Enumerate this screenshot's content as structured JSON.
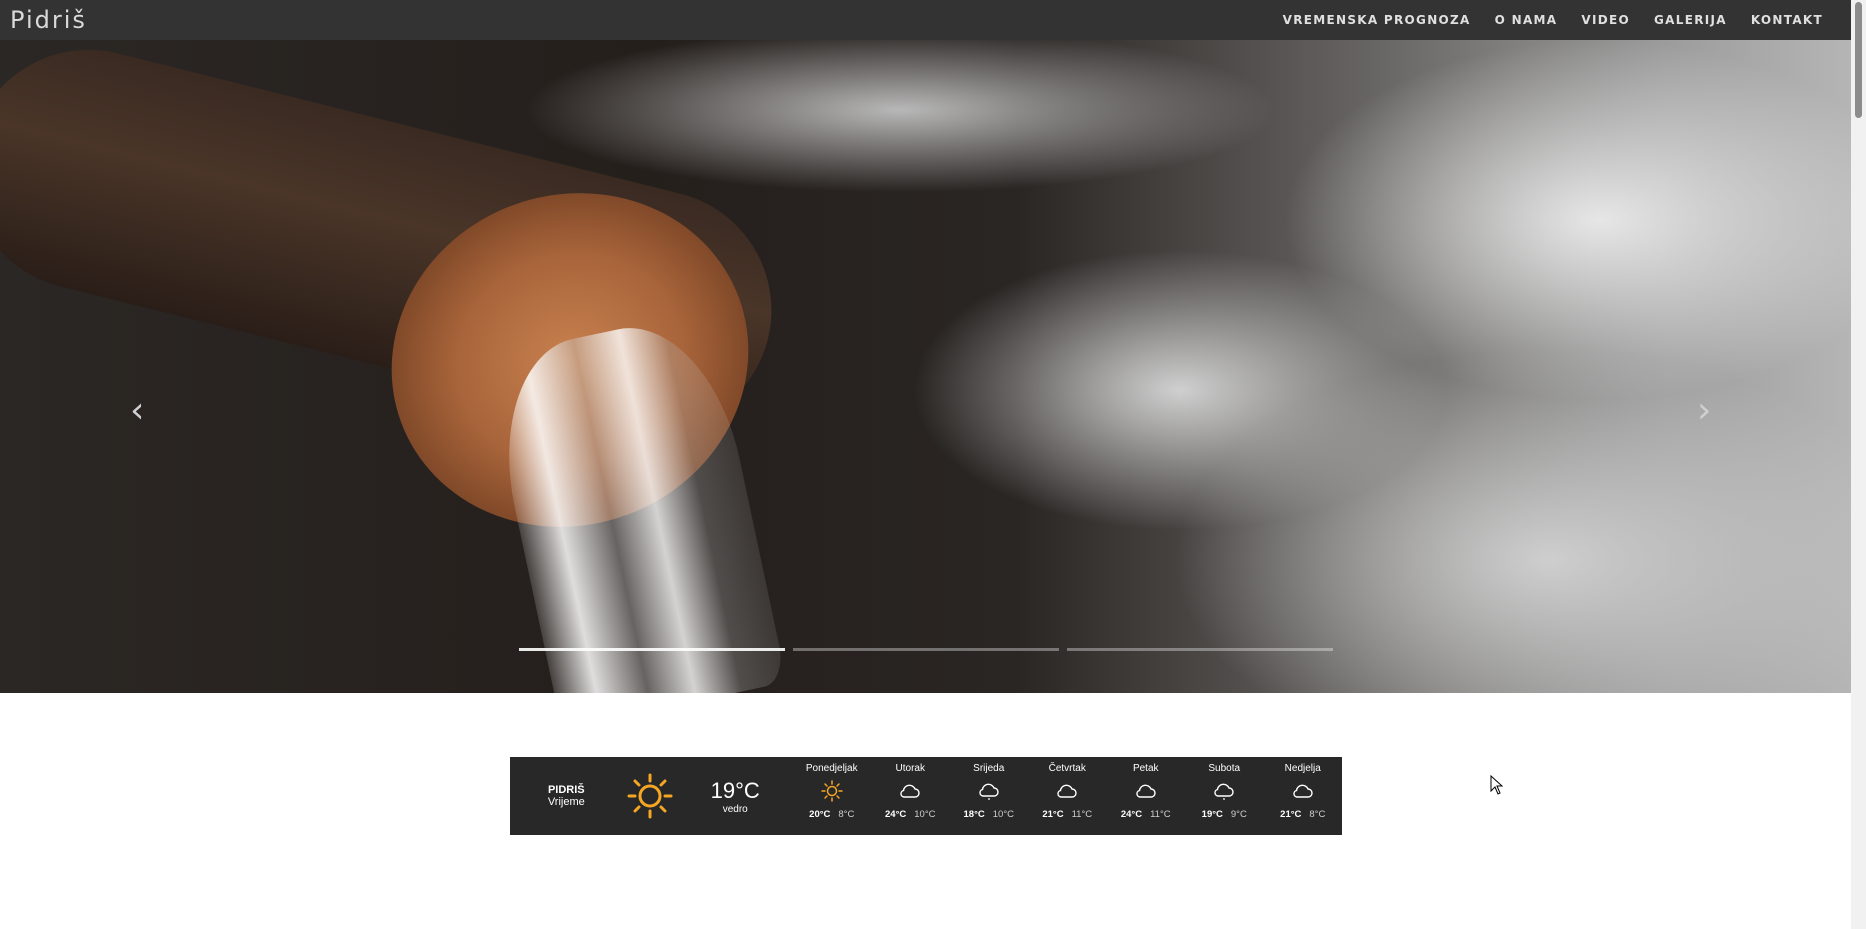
{
  "navbar": {
    "brand": "Pidriš",
    "links": [
      "VREMENSKA PROGNOZA",
      "O NAMA",
      "VIDEO",
      "GALERIJA",
      "KONTAKT"
    ]
  },
  "carousel": {
    "prev_glyph": "‹",
    "next_glyph": "›",
    "slide_count": 3,
    "active_index": 0
  },
  "weather": {
    "location": "PIDRIŠ",
    "label": "Vrijeme",
    "current_icon": "sun-icon",
    "current_temp": "19°C",
    "current_desc": "vedro",
    "days": [
      {
        "name": "Ponedjeljak",
        "icon": "sun-icon",
        "hi": "20°C",
        "lo": "8°C"
      },
      {
        "name": "Utorak",
        "icon": "cloud-icon",
        "hi": "24°C",
        "lo": "10°C"
      },
      {
        "name": "Srijeda",
        "icon": "cloud-drizzle-icon",
        "hi": "18°C",
        "lo": "10°C"
      },
      {
        "name": "Četvrtak",
        "icon": "cloud-icon",
        "hi": "21°C",
        "lo": "11°C"
      },
      {
        "name": "Petak",
        "icon": "cloud-icon",
        "hi": "24°C",
        "lo": "11°C"
      },
      {
        "name": "Subota",
        "icon": "cloud-drizzle-icon",
        "hi": "19°C",
        "lo": "9°C"
      },
      {
        "name": "Nedjelja",
        "icon": "cloud-icon",
        "hi": "21°C",
        "lo": "8°C"
      }
    ],
    "sun_color": "#f5a623"
  }
}
